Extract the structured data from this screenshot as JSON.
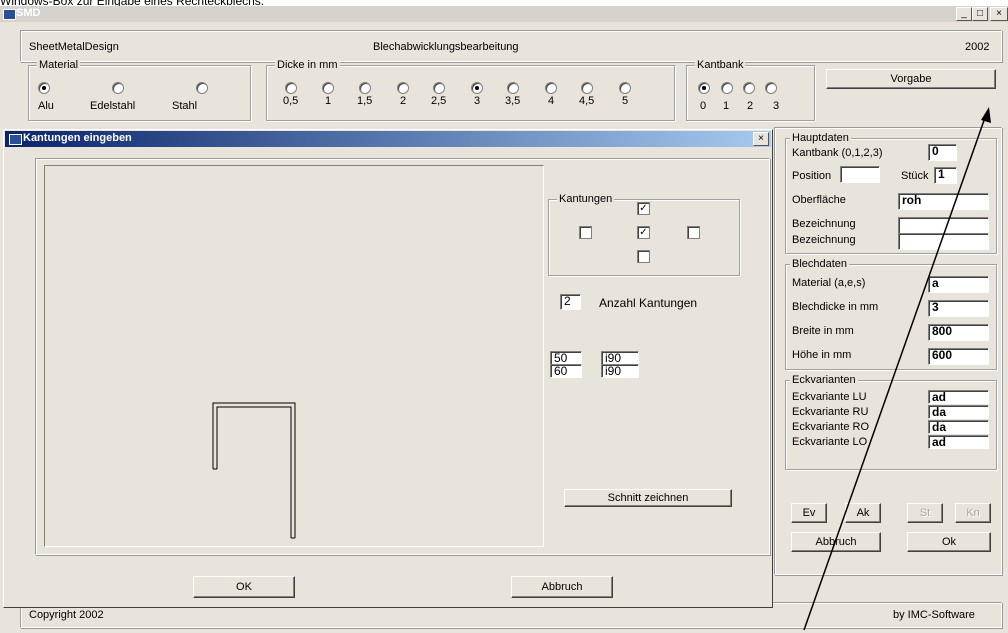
{
  "caption": "Windows-Box zur Eingabe eines Rechteckblechs.",
  "window": {
    "title": "SMD",
    "controls": [
      "_",
      "□",
      "×"
    ]
  },
  "header": {
    "left": "SheetMetalDesign",
    "center": "Blechabwicklungsbearbeitung",
    "right": "2002"
  },
  "material": {
    "label": "Material",
    "options": [
      {
        "label": "Alu",
        "selected": true
      },
      {
        "label": "Edelstahl",
        "selected": false
      },
      {
        "label": "Stahl",
        "selected": false
      }
    ]
  },
  "dicke": {
    "label": "Dicke in mm",
    "options": [
      {
        "label": "0,5",
        "selected": false
      },
      {
        "label": "1",
        "selected": false
      },
      {
        "label": "1,5",
        "selected": false
      },
      {
        "label": "2",
        "selected": false
      },
      {
        "label": "2,5",
        "selected": false
      },
      {
        "label": "3",
        "selected": true
      },
      {
        "label": "3,5",
        "selected": false
      },
      {
        "label": "4",
        "selected": false
      },
      {
        "label": "4,5",
        "selected": false
      },
      {
        "label": "5",
        "selected": false
      }
    ]
  },
  "kantbank": {
    "label": "Kantbank",
    "options": [
      {
        "label": "0",
        "selected": true
      },
      {
        "label": "1",
        "selected": false
      },
      {
        "label": "2",
        "selected": false
      },
      {
        "label": "3",
        "selected": false
      }
    ]
  },
  "vorgabe_button": "Vorgabe",
  "dialog": {
    "title": "Kantungen eingeben",
    "close": "×",
    "kantungen_label": "Kantungen",
    "checks": {
      "top": true,
      "left": false,
      "center": true,
      "right": false,
      "bottom": false
    },
    "anzahl_value": "2",
    "anzahl_label": "Anzahl Kantungen",
    "rows": [
      {
        "len": "50",
        "angle": "i90"
      },
      {
        "len": "60",
        "angle": "i90"
      }
    ],
    "schnitt_button": "Schnitt zeichnen",
    "ok_button": "OK",
    "abbruch_button": "Abbruch"
  },
  "hauptdaten": {
    "label": "Hauptdaten",
    "kantbank_label": "Kantbank (0,1,2,3)",
    "kantbank_value": "0",
    "position_label": "Position",
    "position_value": "",
    "stueck_label": "Stück",
    "stueck_value": "1",
    "oberflaeche_label": "Oberfläche",
    "oberflaeche_value": "roh",
    "bezeichnung1_label": "Bezeichnung",
    "bezeichnung1_value": "",
    "bezeichnung2_label": "Bezeichnung",
    "bezeichnung2_value": ""
  },
  "blechdaten": {
    "label": "Blechdaten",
    "material_label": "Material (a,e,s)",
    "material_value": "a",
    "dicke_label": "Blechdicke in mm",
    "dicke_value": "3",
    "breite_label": "Breite in mm",
    "breite_value": "800",
    "hoehe_label": "Höhe in mm",
    "hoehe_value": "600"
  },
  "eckvarianten": {
    "label": "Eckvarianten",
    "items": [
      {
        "label": "Eckvariante LU",
        "value": "ad"
      },
      {
        "label": "Eckvariante RU",
        "value": "da"
      },
      {
        "label": "Eckvariante RO",
        "value": "da"
      },
      {
        "label": "Eckvariante LO",
        "value": "ad"
      }
    ]
  },
  "buttons": {
    "ev": "Ev",
    "ak": "Ak",
    "st": "St",
    "kn": "Kn",
    "abbruch": "Abbruch",
    "ok": "Ok"
  },
  "footer": {
    "left": "Copyright 2002",
    "right": "by IMC-Software"
  }
}
